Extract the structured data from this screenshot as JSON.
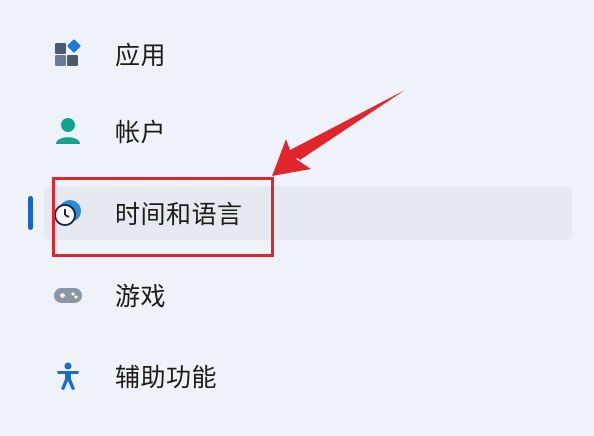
{
  "nav": {
    "items": [
      {
        "label": "应用",
        "icon": "apps-icon"
      },
      {
        "label": "帐户",
        "icon": "account-icon"
      },
      {
        "label": "时间和语言",
        "icon": "time-language-icon",
        "selected": true
      },
      {
        "label": "游戏",
        "icon": "gamepad-icon"
      },
      {
        "label": "辅助功能",
        "icon": "accessibility-icon"
      }
    ]
  },
  "colors": {
    "background": "#eff2f8",
    "selected_background": "#e6e9ef",
    "accent": "#1a64c8",
    "annotation": "#e0262c"
  }
}
